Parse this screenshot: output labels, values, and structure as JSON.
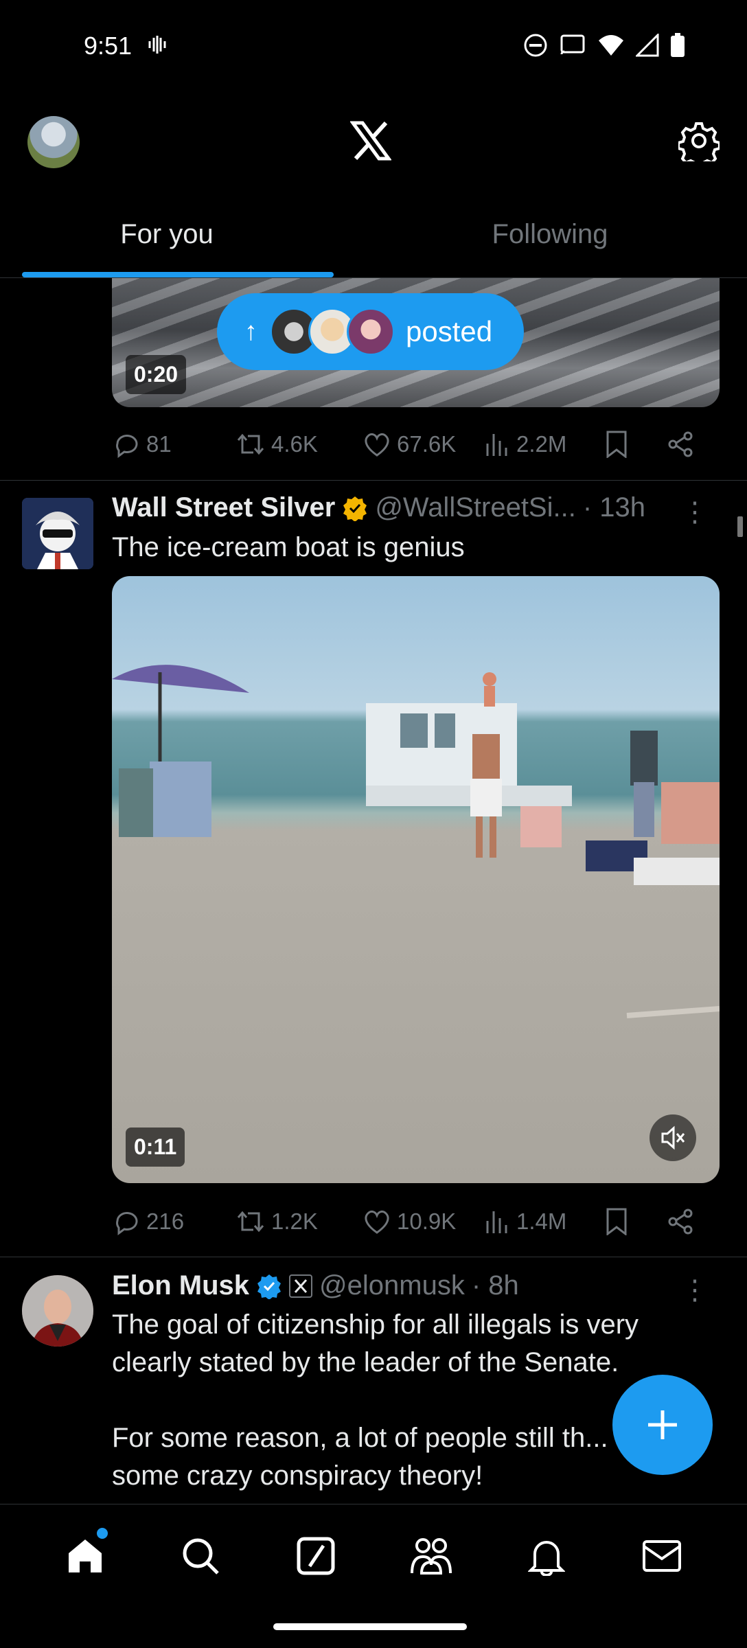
{
  "status_bar": {
    "time": "9:51"
  },
  "header": {
    "avatar": "profile-avatar",
    "logo": "x-logo-icon",
    "settings": "gear-icon"
  },
  "tabs": [
    {
      "label": "For you",
      "active": true
    },
    {
      "label": "Following",
      "active": false
    }
  ],
  "prev_post": {
    "duration": "0:20",
    "banner_label": "posted",
    "stats": {
      "replies": "81",
      "reposts": "4.6K",
      "likes": "67.6K",
      "views": "2.2M"
    }
  },
  "tweets": [
    {
      "name": "Wall Street Silver",
      "handle": "@WallStreetSi...",
      "time": "· 13h",
      "verified": "gold",
      "text": "The ice-cream boat is genius",
      "duration": "0:11",
      "stats": {
        "replies": "216",
        "reposts": "1.2K",
        "likes": "10.9K",
        "views": "1.4M"
      }
    },
    {
      "name": "Elon Musk",
      "handle": "@elonmusk",
      "time": "· 8h",
      "verified": "blue",
      "text": "The goal of citizenship for all illegals is very clearly stated by the leader of the Senate.\n\nFor some reason, a lot of people still th... s is some crazy conspiracy theory!"
    }
  ],
  "colors": {
    "accent": "#1d9bf0",
    "gold": "#f4b400",
    "muted": "#71767b"
  }
}
